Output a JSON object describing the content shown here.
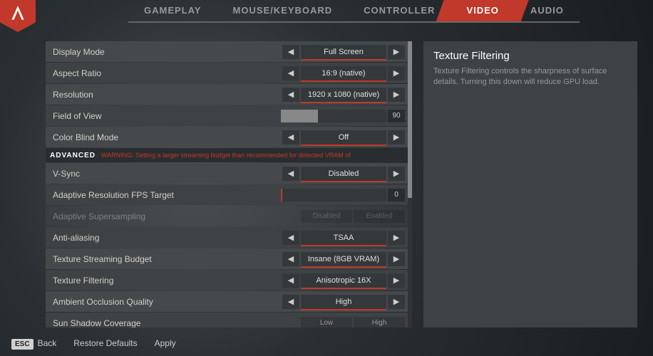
{
  "tabs": [
    "GAMEPLAY",
    "MOUSE/KEYBOARD",
    "CONTROLLER",
    "VIDEO",
    "AUDIO"
  ],
  "activeTab": 3,
  "rows": {
    "display_mode": {
      "label": "Display Mode",
      "value": "Full Screen"
    },
    "aspect_ratio": {
      "label": "Aspect Ratio",
      "value": "16:9 (native)"
    },
    "resolution": {
      "label": "Resolution",
      "value": "1920 x 1080 (native)"
    },
    "fov": {
      "label": "Field of View",
      "value": "90",
      "fill": 35
    },
    "color_blind": {
      "label": "Color Blind Mode",
      "value": "Off"
    },
    "vsync": {
      "label": "V-Sync",
      "value": "Disabled"
    },
    "adaptive_fps": {
      "label": "Adaptive Resolution FPS Target",
      "value": "0"
    },
    "supersampling": {
      "label": "Adaptive Supersampling",
      "left": "Disabled",
      "right": "Enabled"
    },
    "aa": {
      "label": "Anti-aliasing",
      "value": "TSAA"
    },
    "tex_budget": {
      "label": "Texture Streaming Budget",
      "value": "Insane (8GB VRAM)"
    },
    "tex_filter": {
      "label": "Texture Filtering",
      "value": "Anisotropic 16X"
    },
    "ao": {
      "label": "Ambient Occlusion Quality",
      "value": "High"
    },
    "sun_shadow": {
      "label": "Sun Shadow Coverage",
      "left": "Low",
      "right": "High"
    }
  },
  "section": {
    "title": "ADVANCED",
    "warning": "WARNING: Setting a larger streaming budget than recommended for detected VRAM of"
  },
  "info": {
    "title": "Texture Filtering",
    "desc": "Texture Filtering controls the sharpness of surface details. Turning this down will reduce GPU load."
  },
  "footer": {
    "esc": "ESC",
    "back": "Back",
    "restore": "Restore Defaults",
    "apply": "Apply"
  }
}
